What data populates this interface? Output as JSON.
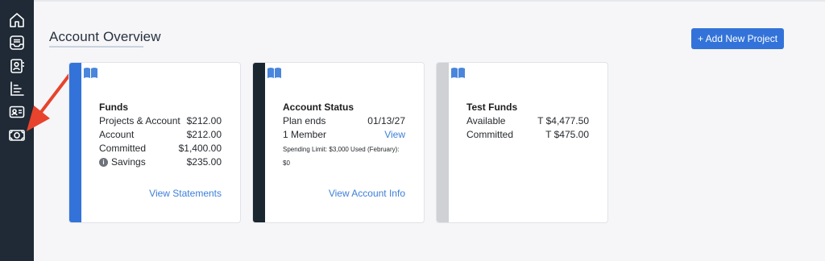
{
  "header": {
    "title": "Account Overview",
    "add_button_label": "+ Add New Project"
  },
  "sidebar": {
    "items": [
      {
        "name": "home",
        "icon": "home-icon"
      },
      {
        "name": "inbox",
        "icon": "inbox-icon"
      },
      {
        "name": "contacts",
        "icon": "contact-book-icon"
      },
      {
        "name": "reports",
        "icon": "list-chart-icon"
      },
      {
        "name": "id-card",
        "icon": "id-card-icon"
      },
      {
        "name": "funds",
        "icon": "money-bill-icon"
      }
    ]
  },
  "cards": {
    "funds": {
      "heading": "Funds",
      "rows": [
        {
          "label": "Projects & Account",
          "value": "$212.00"
        },
        {
          "label": "Account",
          "value": "$212.00"
        },
        {
          "label": "Committed",
          "value": "$1,400.00"
        },
        {
          "label": "Savings",
          "value": "$235.00"
        }
      ],
      "footer_link": "View Statements"
    },
    "status": {
      "heading": "Account Status",
      "plan_label": "Plan ends",
      "plan_value": "01/13/27",
      "members_label": "1 Member",
      "members_link": "View",
      "spending_line1": "Spending Limit: $3,000 Used (February):",
      "spending_line2": "$0",
      "footer_link": "View Account Info"
    },
    "test": {
      "heading": "Test Funds",
      "rows": [
        {
          "label": "Available",
          "value": "T $4,477.50"
        },
        {
          "label": "Committed",
          "value": "T $475.00"
        }
      ]
    }
  },
  "colors": {
    "sidebar": "#1f2a36",
    "accent": "#3373d9",
    "funds_stripe": "#3373d9",
    "status_stripe": "#1a2630",
    "test_stripe": "#cfd1d4",
    "arrow": "#e8432c"
  }
}
